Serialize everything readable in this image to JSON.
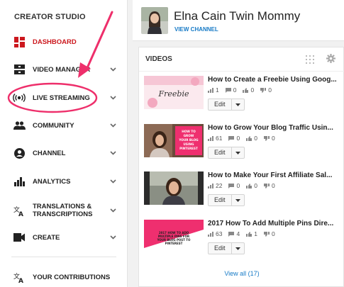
{
  "sidebar": {
    "title": "CREATOR STUDIO",
    "items": [
      {
        "label": "DASHBOARD",
        "icon": "dashboard-icon",
        "active": true
      },
      {
        "label": "VIDEO MANAGER",
        "icon": "video-manager-icon"
      },
      {
        "label": "LIVE STREAMING",
        "icon": "live-streaming-icon"
      },
      {
        "label": "COMMUNITY",
        "icon": "community-icon"
      },
      {
        "label": "CHANNEL",
        "icon": "channel-icon"
      },
      {
        "label": "ANALYTICS",
        "icon": "analytics-icon"
      },
      {
        "label": "TRANSLATIONS & TRANSCRIPTIONS",
        "icon": "translations-icon"
      },
      {
        "label": "CREATE",
        "icon": "create-icon"
      }
    ],
    "contributions": {
      "label": "YOUR CONTRIBUTIONS",
      "icon": "translate-icon"
    }
  },
  "channel": {
    "name": "Elna Cain Twin Mommy",
    "view_link": "VIEW CHANNEL"
  },
  "videos": {
    "title": "VIDEOS",
    "items": [
      {
        "title": "How to Create a Freebie Using Goog...",
        "views": "1",
        "comments": "0",
        "likes": "0",
        "dislikes": "0",
        "thumb_text": "Freebie"
      },
      {
        "title": "How to Grow Your Blog Traffic Usin...",
        "views": "61",
        "comments": "0",
        "likes": "0",
        "dislikes": "0",
        "thumb_text": "HOW TO GROW YOUR BLOG USING PINTEREST"
      },
      {
        "title": "How to Make Your First Affiliate Sal...",
        "views": "22",
        "comments": "0",
        "likes": "0",
        "dislikes": "0",
        "thumb_text": ""
      },
      {
        "title": "2017 How To Add Multiple Pins Dire...",
        "views": "63",
        "comments": "4",
        "likes": "1",
        "dislikes": "0",
        "thumb_text": "2017 HOW TO ADD MULTIPLE PINS FOR YOUR BLOG POST TO PINTEREST"
      }
    ],
    "edit_label": "Edit",
    "view_all": "View all (17)"
  },
  "colors": {
    "accent_red": "#cc181e",
    "link_blue": "#167ac6",
    "annotation_pink": "#ee2f6b"
  }
}
